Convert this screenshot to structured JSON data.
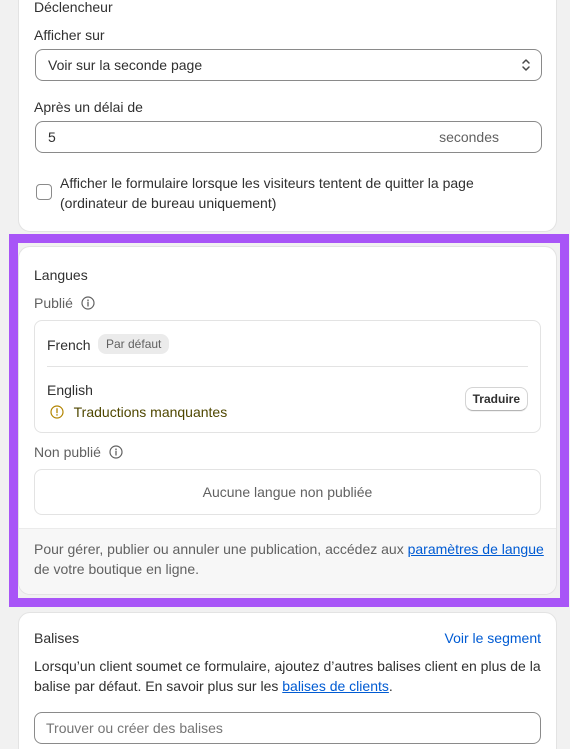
{
  "trigger": {
    "section_title": "Déclencheur",
    "show_on_label": "Afficher sur",
    "show_on_value": "Voir sur la seconde page",
    "delay_label": "Après un délai de",
    "delay_value": "5",
    "delay_suffix": "secondes",
    "exit_intent_label_line1": "Afficher le formulaire lorsque les visiteurs tentent de quitter la page",
    "exit_intent_label_line2": "(ordinateur de bureau uniquement)"
  },
  "languages": {
    "title": "Langues",
    "published_label": "Publié",
    "published_items": [
      {
        "name": "French",
        "badge": "Par défaut"
      },
      {
        "name": "English",
        "warning": "Traductions manquantes",
        "action": "Traduire"
      }
    ],
    "unpublished_label": "Non publié",
    "unpublished_empty": "Aucune langue non publiée",
    "footer_text_before": "Pour gérer, publier ou annuler une publication, accédez aux ",
    "footer_link": "paramètres de langue",
    "footer_text_after": "de votre boutique en ligne."
  },
  "tags": {
    "title": "Balises",
    "segment_link": "Voir le segment",
    "description_line1": "Lorsqu’un client soumet ce formulaire, ajoutez d’autres balises client en plus de la",
    "description_line2_before": "balise par défaut. En savoir plus sur les ",
    "description_link": "balises de clients",
    "description_line2_after": ".",
    "input_placeholder": "Trouver ou créer des balises"
  },
  "colors": {
    "highlight": "#a855f7",
    "link": "#005bd3",
    "warning_text": "#4f4700",
    "warning_icon": "#b28400"
  }
}
